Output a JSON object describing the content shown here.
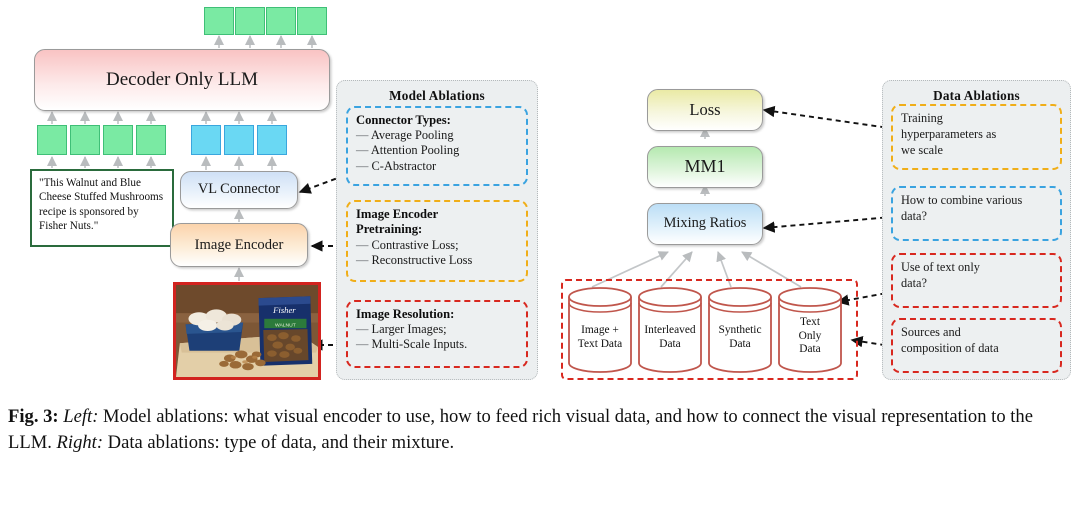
{
  "figure": {
    "label": "Fig. 3:",
    "caption_left_tag": "Left:",
    "caption_part1": " Model ablations: what visual encoder to use, how to feed rich visual data, and how to connect the visual representation to the LLM. ",
    "caption_right_tag": "Right:",
    "caption_part2": " Data ablations: type of data, and their mixture."
  },
  "colors": {
    "token_green": "#7aeaa3",
    "token_blue": "#6ad8f3",
    "decoder_pink": "#f9c3c3",
    "connector_blue": "#cfe0f5",
    "encoder_orange": "#fbd3ab",
    "loss_yellow": "#eaeaa5",
    "mm1_green": "#b5e9b0",
    "mixing_blue": "#bcdef6",
    "accent_blue": "#3aa3e0",
    "accent_orange": "#f0ae18",
    "accent_red": "#d8281f",
    "accent_green": "#2a6b3c",
    "panel_grey": "#eceff0"
  },
  "left": {
    "decoder": "Decoder Only LLM",
    "vl_connector": "VL Connector",
    "image_encoder": "Image Encoder",
    "text_prompt": "\"This Walnut and Blue Cheese Stuffed Mushrooms recipe is sponsored by Fisher Nuts.\"",
    "photo_alt": "photo of mushrooms, Fisher walnuts bag and chopped walnuts on a cutting board",
    "output_tokens": 4,
    "text_tokens": 4,
    "image_tokens": 3
  },
  "model_ablations": {
    "title": "Model Ablations",
    "cards": [
      {
        "id": "connector-types",
        "accent": "blue",
        "heading": "Connector Types:",
        "items": [
          "Average Pooling",
          "Attention Pooling",
          "C-Abstractor"
        ]
      },
      {
        "id": "image-encoder-pretraining",
        "accent": "orange",
        "heading_line1": "Image Encoder",
        "heading_line2": "Pretraining:",
        "items": [
          "Contrastive Loss;",
          "Reconstructive Loss"
        ]
      },
      {
        "id": "image-resolution",
        "accent": "red",
        "heading": "Image Resolution:",
        "items": [
          "Larger Images;",
          "Multi-Scale Inputs."
        ]
      }
    ]
  },
  "right": {
    "loss": "Loss",
    "model": "MM1",
    "mixing_ratios": "Mixing Ratios",
    "data_sources": [
      {
        "line1": "Image +",
        "line2": "Text Data"
      },
      {
        "line1": "Interleaved",
        "line2": "Data"
      },
      {
        "line1": "Synthetic",
        "line2": "Data"
      },
      {
        "line1": "Text",
        "line2": "Only",
        "line3": "Data"
      }
    ]
  },
  "data_ablations": {
    "title": "Data Ablations",
    "cards": [
      {
        "id": "training-hyperparameters",
        "accent": "orange",
        "lines": [
          "Training",
          "hyperparameters as",
          "we scale"
        ]
      },
      {
        "id": "combine-various-data",
        "accent": "blue",
        "lines": [
          "How to combine various",
          "data?"
        ]
      },
      {
        "id": "text-only-data",
        "accent": "red",
        "lines": [
          "Use of text only",
          "data?"
        ]
      },
      {
        "id": "sources-composition",
        "accent": "red",
        "lines": [
          "Sources and",
          "composition of data"
        ]
      }
    ]
  }
}
